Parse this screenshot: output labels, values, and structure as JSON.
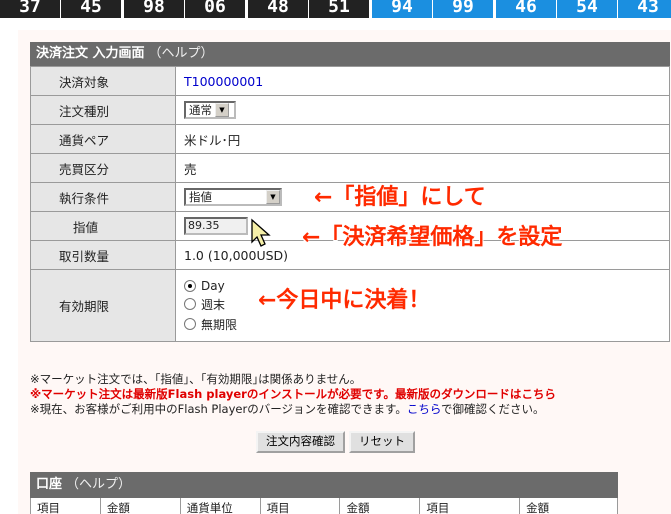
{
  "ticker": {
    "dark": [
      "37",
      "45",
      "98",
      "06",
      "48",
      "51"
    ],
    "blue": [
      "94",
      "99",
      "46",
      "54",
      "43"
    ]
  },
  "panel": {
    "title": "決済注文 入力画面",
    "help": "（ヘルプ）",
    "rows": {
      "target_label": "決済対象",
      "target_value": "T100000001",
      "order_type_label": "注文種別",
      "order_type_value": "通常",
      "pair_label": "通貨ペア",
      "pair_value": "米ドル･円",
      "side_label": "売買区分",
      "side_value": "売",
      "exec_label": "執行条件",
      "exec_value": "指値",
      "limit_label": "指値",
      "limit_value": "89.35",
      "qty_label": "取引数量",
      "qty_value": "1.0 (10,000USD)",
      "expiry_label": "有効期限",
      "expiry_options": [
        "Day",
        "週末",
        "無期限"
      ]
    }
  },
  "annotations": {
    "a1": "←「指値」にして",
    "a2": "←「決済希望価格」を設定",
    "a3": "←今日中に決着！"
  },
  "notes": {
    "line1": "※マーケット注文では、｢指値｣、｢有効期限｣は関係ありません。",
    "line2_red": "※マーケット注文は最新版Flash playerのインストールが必要です。最新版のダウンロードは",
    "line2_link": "こちら",
    "line3_a": "※現在、お客様がご利用中のFlash Playerのバージョンを確認できます。",
    "line3_link": "こちら",
    "line3_b": "で御確認ください。"
  },
  "buttons": {
    "confirm": "注文内容確認",
    "reset": "リセット"
  },
  "account": {
    "title": "口座",
    "help": "（ヘルプ）",
    "columns": [
      "項目",
      "金額",
      "通貨単位",
      "項目",
      "金額",
      "項目",
      "金額"
    ]
  },
  "colors": {
    "accent_red": "#ff2a00",
    "ticker_blue": "#1b8fe0",
    "header_gray": "#6b6b6b"
  }
}
